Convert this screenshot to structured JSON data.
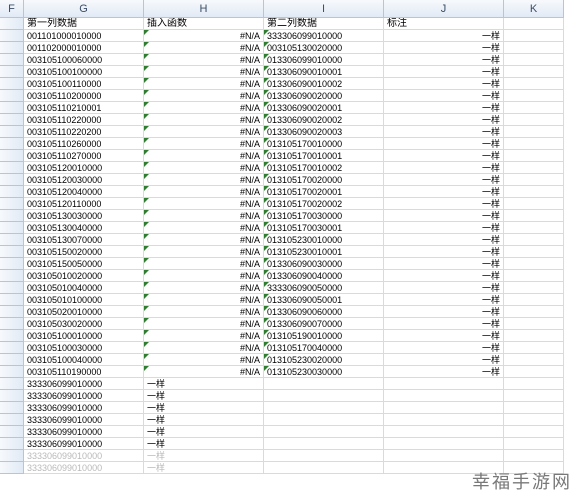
{
  "columns": [
    "F",
    "G",
    "H",
    "I",
    "J",
    "K"
  ],
  "headers": {
    "g": "第一列数据",
    "h": "插入函数",
    "i": "第二列数据",
    "j": "标注"
  },
  "rows": [
    {
      "g": "001101000010000",
      "h": "#N/A",
      "i": "333306099010000",
      "j": "一样",
      "tick": true
    },
    {
      "g": "001102000010000",
      "h": "#N/A",
      "i": "003105130020000",
      "j": "一样",
      "tick": true
    },
    {
      "g": "003105100060000",
      "h": "#N/A",
      "i": "013306099010000",
      "j": "一样",
      "tick": true
    },
    {
      "g": "003105100100000",
      "h": "#N/A",
      "i": "013306090010001",
      "j": "一样",
      "tick": true
    },
    {
      "g": "003105100110000",
      "h": "#N/A",
      "i": "013306090010002",
      "j": "一样",
      "tick": true
    },
    {
      "g": "003105110200000",
      "h": "#N/A",
      "i": "013306090020000",
      "j": "一样",
      "tick": true
    },
    {
      "g": "003105110210001",
      "h": "#N/A",
      "i": "013306090020001",
      "j": "一样",
      "tick": true
    },
    {
      "g": "003105110220000",
      "h": "#N/A",
      "i": "013306090020002",
      "j": "一样",
      "tick": true
    },
    {
      "g": "003105110220200",
      "h": "#N/A",
      "i": "013306090020003",
      "j": "一样",
      "tick": true
    },
    {
      "g": "003105110260000",
      "h": "#N/A",
      "i": "013105170010000",
      "j": "一样",
      "tick": true
    },
    {
      "g": "003105110270000",
      "h": "#N/A",
      "i": "013105170010001",
      "j": "一样",
      "tick": true
    },
    {
      "g": "003105120010000",
      "h": "#N/A",
      "i": "013105170010002",
      "j": "一样",
      "tick": true
    },
    {
      "g": "003105120030000",
      "h": "#N/A",
      "i": "013105170020000",
      "j": "一样",
      "tick": true
    },
    {
      "g": "003105120040000",
      "h": "#N/A",
      "i": "013105170020001",
      "j": "一样",
      "tick": true
    },
    {
      "g": "003105120110000",
      "h": "#N/A",
      "i": "013105170020002",
      "j": "一样",
      "tick": true
    },
    {
      "g": "003105130030000",
      "h": "#N/A",
      "i": "013105170030000",
      "j": "一样",
      "tick": true
    },
    {
      "g": "003105130040000",
      "h": "#N/A",
      "i": "013105170030001",
      "j": "一样",
      "tick": true
    },
    {
      "g": "003105130070000",
      "h": "#N/A",
      "i": "013105230010000",
      "j": "一样",
      "tick": true
    },
    {
      "g": "003105150020000",
      "h": "#N/A",
      "i": "013105230010001",
      "j": "一样",
      "tick": true
    },
    {
      "g": "003105150050000",
      "h": "#N/A",
      "i": "013306090030000",
      "j": "一样",
      "tick": true
    },
    {
      "g": "003105010020000",
      "h": "#N/A",
      "i": "013306090040000",
      "j": "一样",
      "tick": true
    },
    {
      "g": "003105010040000",
      "h": "#N/A",
      "i": "333306090050000",
      "j": "一样",
      "tick": true
    },
    {
      "g": "003105010100000",
      "h": "#N/A",
      "i": "013306090050001",
      "j": "一样",
      "tick": true
    },
    {
      "g": "003105020010000",
      "h": "#N/A",
      "i": "013306090060000",
      "j": "一样",
      "tick": true
    },
    {
      "g": "003105030020000",
      "h": "#N/A",
      "i": "013306090070000",
      "j": "一样",
      "tick": true
    },
    {
      "g": "003105100010000",
      "h": "#N/A",
      "i": "013105190010000",
      "j": "一样",
      "tick": true
    },
    {
      "g": "003105100030000",
      "h": "#N/A",
      "i": "013105170040000",
      "j": "一样",
      "tick": true
    },
    {
      "g": "003105100040000",
      "h": "#N/A",
      "i": "013105230020000",
      "j": "一样",
      "tick": true
    },
    {
      "g": "003105110190000",
      "h": "#N/A",
      "i": "013105230030000",
      "j": "一样",
      "tick": true
    },
    {
      "g": "333306099010000",
      "h": "一样",
      "i": "",
      "j": "",
      "tick": false
    },
    {
      "g": "333306099010000",
      "h": "一样",
      "i": "",
      "j": "",
      "tick": false
    },
    {
      "g": "333306099010000",
      "h": "一样",
      "i": "",
      "j": "",
      "tick": false
    },
    {
      "g": "333306099010000",
      "h": "一样",
      "i": "",
      "j": "",
      "tick": false
    },
    {
      "g": "333306099010000",
      "h": "一样",
      "i": "",
      "j": "",
      "tick": false
    },
    {
      "g": "333306099010000",
      "h": "一样",
      "i": "",
      "j": "",
      "tick": false
    },
    {
      "g": "333306099010000",
      "h": "一样",
      "i": "",
      "j": "",
      "tick": false,
      "gray": true
    },
    {
      "g": "333306099010000",
      "h": "一样",
      "i": "",
      "j": "",
      "tick": false,
      "gray": true
    }
  ],
  "watermark": "幸福手游网"
}
